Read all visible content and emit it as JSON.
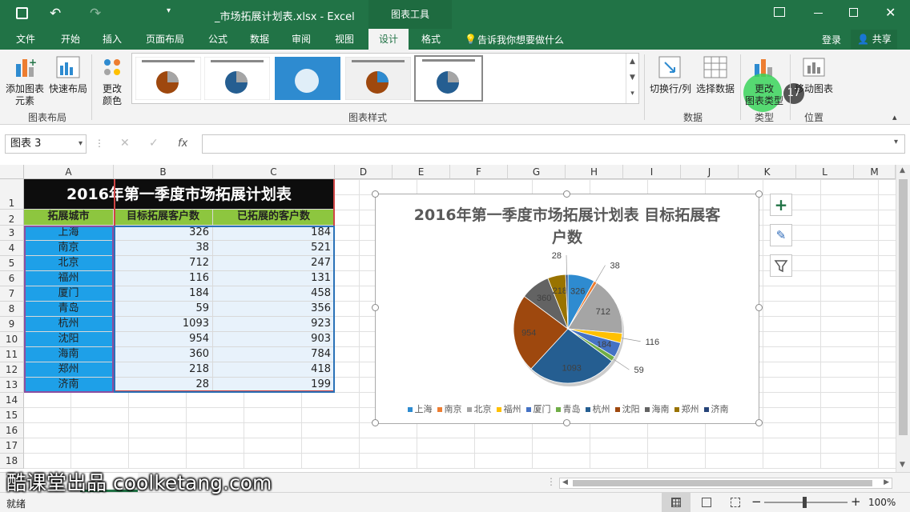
{
  "window": {
    "file_title": "_市场拓展计划表.xlsx - Excel",
    "context_title": "图表工具"
  },
  "tabs": [
    "文件",
    "开始",
    "插入",
    "页面布局",
    "公式",
    "数据",
    "审阅",
    "视图",
    "设计",
    "格式"
  ],
  "tell_me": "告诉我你想要做什么",
  "login": "登录",
  "share": "共享",
  "ribbon": {
    "add_element": "添加图表\n元素",
    "quick_layout": "快速布局",
    "change_color": "更改\n颜色",
    "switch_row_col": "切换行/列",
    "select_data": "选择数据",
    "change_type": "更改\n图表类型",
    "move_chart": "移动图表",
    "groups": {
      "layout": "图表布局",
      "styles": "图表样式",
      "data": "数据",
      "type": "类型",
      "location": "位置"
    },
    "step_badge": "17"
  },
  "namebox": "图表 3",
  "fx": "fx",
  "columns": [
    "A",
    "B",
    "C",
    "D",
    "E",
    "F",
    "G",
    "H",
    "I",
    "J",
    "K",
    "L",
    "M"
  ],
  "rows": [
    "1",
    "2",
    "3",
    "4",
    "5",
    "6",
    "7",
    "8",
    "9",
    "10",
    "11",
    "12",
    "13",
    "14",
    "15",
    "16",
    "17",
    "18"
  ],
  "sheet": {
    "title": "2016年第一季度市场拓展计划表",
    "headers": [
      "拓展城市",
      "目标拓展客户数",
      "已拓展的客户数"
    ],
    "data": [
      [
        "上海",
        "326",
        "184"
      ],
      [
        "南京",
        "38",
        "521"
      ],
      [
        "北京",
        "712",
        "247"
      ],
      [
        "福州",
        "116",
        "131"
      ],
      [
        "厦门",
        "184",
        "458"
      ],
      [
        "青岛",
        "59",
        "356"
      ],
      [
        "杭州",
        "1093",
        "923"
      ],
      [
        "沈阳",
        "954",
        "903"
      ],
      [
        "海南",
        "360",
        "784"
      ],
      [
        "郑州",
        "218",
        "418"
      ],
      [
        "济南",
        "28",
        "199"
      ]
    ]
  },
  "chart_data": {
    "type": "pie",
    "title": "2016年第一季度市场拓展计划表 目标拓展客户数",
    "categories": [
      "上海",
      "南京",
      "北京",
      "福州",
      "厦门",
      "青岛",
      "杭州",
      "沈阳",
      "海南",
      "郑州",
      "济南"
    ],
    "values": [
      326,
      38,
      712,
      116,
      184,
      59,
      1093,
      954,
      360,
      218,
      28
    ],
    "colors": [
      "#2e8bd0",
      "#ed7d31",
      "#a5a5a5",
      "#ffc000",
      "#4472c4",
      "#70ad47",
      "#255e91",
      "#9e480e",
      "#636363",
      "#997300",
      "#264478"
    ],
    "legend": "bottom"
  },
  "status": {
    "ready": "就绪",
    "zoom": "100%"
  },
  "watermark": "酷课堂出品 coolketang.com"
}
